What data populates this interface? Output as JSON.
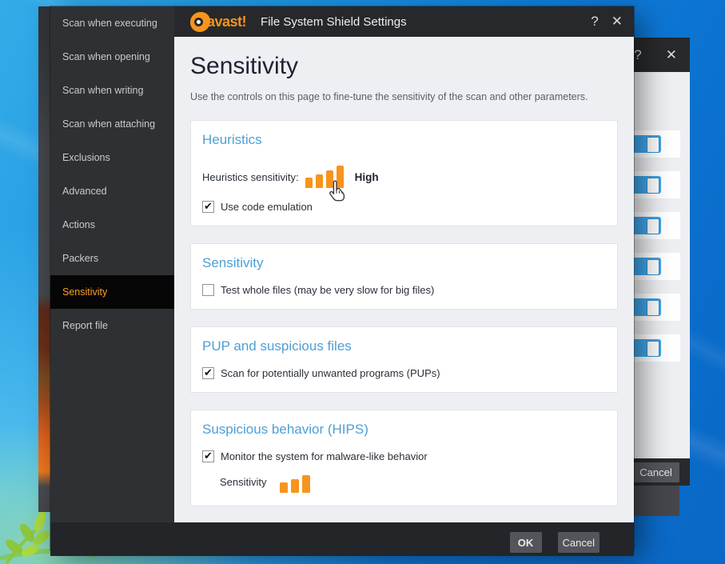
{
  "colors": {
    "avast_orange": "#f7941d",
    "heading_blue": "#4d9fd7",
    "toggle_blue": "#3fa5e8",
    "selected_item_orange": "#f8a01c"
  },
  "background_dialog": {
    "help_label": "?",
    "close_label": "✕",
    "cancel_label": "Cancel",
    "toggles_on": [
      true,
      true,
      true,
      true,
      true,
      true
    ]
  },
  "dialog": {
    "titlebar": {
      "logo_text": "avast!",
      "title": "File System Shield Settings",
      "help_label": "?",
      "close_label": "✕"
    },
    "sidebar": {
      "items": [
        {
          "label": "Scan when executing",
          "selected": false
        },
        {
          "label": "Scan when opening",
          "selected": false
        },
        {
          "label": "Scan when writing",
          "selected": false
        },
        {
          "label": "Scan when attaching",
          "selected": false
        },
        {
          "label": "Exclusions",
          "selected": false
        },
        {
          "label": "Advanced",
          "selected": false
        },
        {
          "label": "Actions",
          "selected": false
        },
        {
          "label": "Packers",
          "selected": false
        },
        {
          "label": "Sensitivity",
          "selected": true
        },
        {
          "label": "Report file",
          "selected": false
        }
      ]
    },
    "page": {
      "title": "Sensitivity",
      "subtitle": "Use the controls on this page to fine-tune the sensitivity of the scan and other parameters.",
      "sections": {
        "heuristics": {
          "heading": "Heuristics",
          "slider_label": "Heuristics sensitivity:",
          "slider_value": "High",
          "slider_level": 4,
          "slider_max": 4,
          "checkbox": {
            "label": "Use code emulation",
            "checked": true
          }
        },
        "sensitivity": {
          "heading": "Sensitivity",
          "checkbox": {
            "label": "Test whole files (may be very slow for big files)",
            "checked": false
          }
        },
        "pup": {
          "heading": "PUP and suspicious files",
          "checkbox": {
            "label": "Scan for potentially unwanted programs (PUPs)",
            "checked": true
          }
        },
        "hips": {
          "heading": "Suspicious behavior (HIPS)",
          "checkbox": {
            "label": "Monitor the system for malware-like behavior",
            "checked": true
          },
          "slider_label": "Sensitivity",
          "slider_level": 3,
          "slider_max": 3
        }
      }
    },
    "footer": {
      "ok_label": "OK",
      "cancel_label": "Cancel"
    }
  }
}
